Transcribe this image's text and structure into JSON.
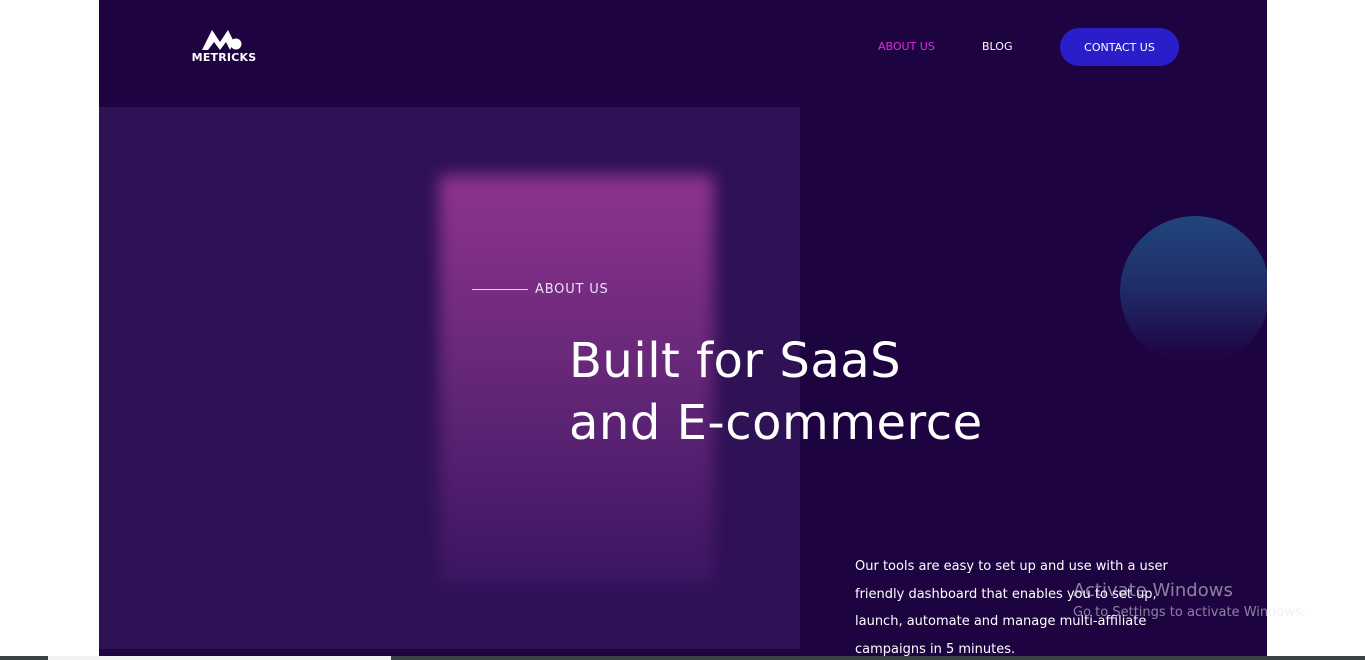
{
  "brand": {
    "name": "METRICKS",
    "logo_icon": "metricks-m-icon"
  },
  "nav": {
    "items": [
      {
        "label": "ABOUT US",
        "active": true
      },
      {
        "label": "BLOG",
        "active": false
      }
    ],
    "contact_label": "CONTACT US"
  },
  "hero": {
    "eyebrow": "ABOUT US",
    "headline_line1": "Built for SaaS",
    "headline_line2": "and E-commerce",
    "description": "Our tools are easy to set up and use with a user friendly dashboard that enables you to set up, launch, automate and manage multi-affiliate campaigns in 5 minutes."
  },
  "watermark": {
    "title": "Activate Windows",
    "subtitle": "Go to Settings to activate Windows."
  },
  "colors": {
    "background": "#1e0341",
    "panel": "#2f1155",
    "accent_active_nav": "#e22ce0",
    "button": "#2a1ecb",
    "text": "#ffffff"
  }
}
